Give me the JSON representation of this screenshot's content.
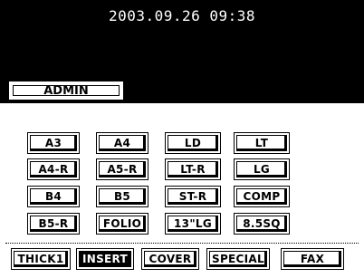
{
  "header": {
    "datetime": "2003.09.26 09:38"
  },
  "tab": {
    "label": "ADMIN"
  },
  "paper_sizes": [
    [
      "A3",
      "A4",
      "LD",
      "LT"
    ],
    [
      "A4-R",
      "A5-R",
      "LT-R",
      "LG"
    ],
    [
      "B4",
      "B5",
      "ST-R",
      "COMP"
    ],
    [
      "B5-R",
      "FOLIO",
      "13\"LG",
      "8.5SQ"
    ]
  ],
  "paper_types": {
    "thick1": "THICK1",
    "insert": "INSERT",
    "cover": "COVER",
    "special": "SPECIAL",
    "fax": "FAX"
  },
  "colors": {
    "background": "#000000",
    "selected": "#000000"
  },
  "selected_type": "INSERT"
}
